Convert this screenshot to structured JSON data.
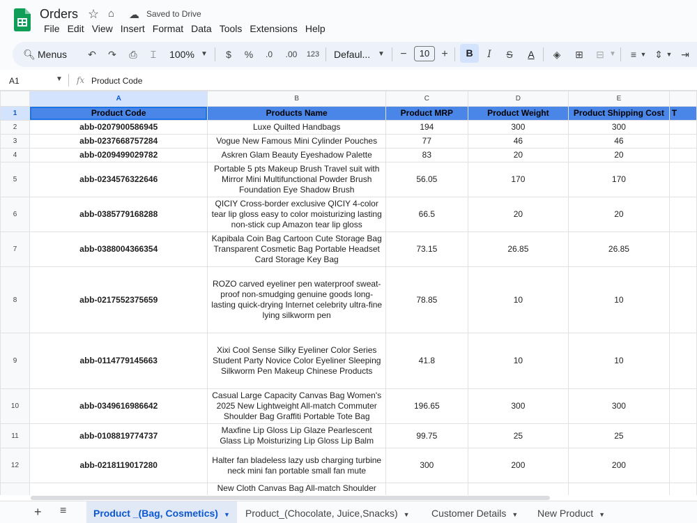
{
  "app": {
    "title": "Orders",
    "save_status": "Saved to Drive"
  },
  "menu": [
    "File",
    "Edit",
    "View",
    "Insert",
    "Format",
    "Data",
    "Tools",
    "Extensions",
    "Help"
  ],
  "toolbar": {
    "search_label": "Menus",
    "zoom": "100%",
    "currency": "$",
    "percent": "%",
    "decrease_decimal": ".0",
    "increase_decimal": ".00",
    "number_format": "123",
    "font": "Defaul...",
    "font_size": "10",
    "bold": "B",
    "italic": "I",
    "text_color": "A"
  },
  "formula_bar": {
    "cell_ref": "A1",
    "fx": "fx",
    "value": "Product Code"
  },
  "columns": [
    "A",
    "B",
    "C",
    "D",
    "E"
  ],
  "header_row": {
    "row_num": "1",
    "cells": [
      "Product Code",
      "Products Name",
      "Product MRP",
      "Product Weight",
      "Product Shipping Cost",
      "T"
    ]
  },
  "rows": [
    {
      "num": "2",
      "code": "abb-0207900586945",
      "name": "Luxe Quilted Handbags",
      "mrp": "194",
      "weight": "300",
      "ship": "300"
    },
    {
      "num": "3",
      "code": "abb-0237668757284",
      "name": "Vogue New Famous Mini Cylinder Pouches",
      "mrp": "77",
      "weight": "46",
      "ship": "46"
    },
    {
      "num": "4",
      "code": "abb-0209499029782",
      "name": "Askren Glam Beauty Eyeshadow Palette",
      "mrp": "83",
      "weight": "20",
      "ship": "20"
    },
    {
      "num": "5",
      "code": "abb-0234576322646",
      "name": "Portable 5 pts Makeup Brush Travel suit with Mirror Mini Multifunctional Powder Brush Foundation Eye Shadow Brush",
      "mrp": "56.05",
      "weight": "170",
      "ship": "170"
    },
    {
      "num": "6",
      "code": "abb-0385779168288",
      "name": "QICIY  Cross-border exclusive QICIY 4-color tear lip gloss easy to color moisturizing lasting non-stick cup Amazon tear lip gloss",
      "mrp": "66.5",
      "weight": "20",
      "ship": "20"
    },
    {
      "num": "7",
      "code": "abb-0388004366354",
      "name": "Kapibala Coin Bag Cartoon Cute Storage Bag Transparent Cosmetic Bag Portable Headset Card Storage Key Bag",
      "mrp": "73.15",
      "weight": "26.85",
      "ship": "26.85"
    },
    {
      "num": "8",
      "code": "abb-0217552375659",
      "name": "ROZO carved eyeliner pen waterproof sweat-proof non-smudging genuine goods long-lasting quick-drying Internet celebrity ultra-fine lying silkworm pen",
      "mrp": "78.85",
      "weight": "10",
      "ship": "10"
    },
    {
      "num": "9",
      "code": "abb-0114779145663",
      "name": "Xixi Cool Sense Silky Eyeliner Color Series Student Party Novice Color Eyeliner Sleeping Silkworm Pen Makeup Chinese Products",
      "mrp": "41.8",
      "weight": "10",
      "ship": "10"
    },
    {
      "num": "10",
      "code": "abb-0349616986642",
      "name": "Casual Large Capacity Canvas Bag Women's 2025 New Lightweight All-match Commuter Shoulder Bag Graffiti Portable Tote Bag",
      "mrp": "196.65",
      "weight": "300",
      "ship": "300"
    },
    {
      "num": "11",
      "code": "abb-0108819774737",
      "name": "Maxfine Lip Gloss Lip Glaze Pearlescent Glass Lip Moisturizing Lip Gloss Lip Balm",
      "mrp": "99.75",
      "weight": "25",
      "ship": "25"
    },
    {
      "num": "12",
      "code": "abb-0218119017280",
      "name": "Halter fan bladeless lazy usb charging turbine neck mini fan portable small fan mute",
      "mrp": "300",
      "weight": "200",
      "ship": "200"
    },
    {
      "num": "",
      "code": "",
      "name": "New Cloth Canvas Bag All-match Shoulder",
      "mrp": "",
      "weight": "",
      "ship": ""
    }
  ],
  "tabs": [
    {
      "label": "Product _(Bag, Cosmetics)",
      "active": true
    },
    {
      "label": "Product_(Chocolate, Juice,Snacks)",
      "active": false
    },
    {
      "label": "Customer Details",
      "active": false
    },
    {
      "label": "New Product",
      "active": false
    }
  ],
  "colors": {
    "header_fill": "#4a86e8",
    "selection": "#d3e3fd",
    "accent": "#0b57d0",
    "logo_green": "#0f9d58"
  }
}
